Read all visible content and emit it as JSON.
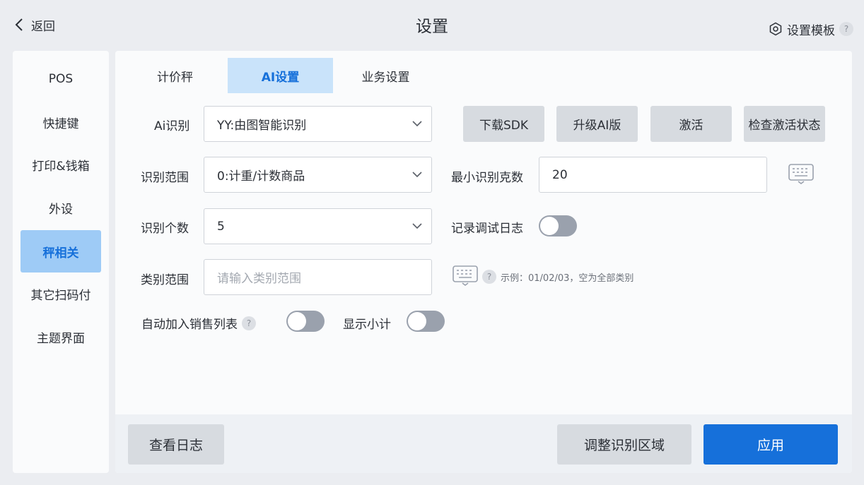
{
  "header": {
    "back_label": "返回",
    "title": "设置",
    "template_label": "设置模板",
    "help_mark": "?"
  },
  "sidebar": {
    "items": [
      {
        "label": "POS"
      },
      {
        "label": "快捷键"
      },
      {
        "label": "打印&钱箱"
      },
      {
        "label": "外设"
      },
      {
        "label": "秤相关",
        "active": true
      },
      {
        "label": "其它扫码付"
      },
      {
        "label": "主题界面"
      }
    ]
  },
  "tabs": [
    {
      "label": "计价秤"
    },
    {
      "label": "AI设置",
      "active": true
    },
    {
      "label": "业务设置"
    }
  ],
  "form": {
    "ai_recognition": {
      "label": "Ai识别",
      "value": "YY:由图智能识别"
    },
    "recognition_range": {
      "label": "识别范围",
      "value": "0:计重/计数商品"
    },
    "recognition_count": {
      "label": "识别个数",
      "value": "5"
    },
    "category_range": {
      "label": "类别范围",
      "placeholder": "请输入类别范围"
    },
    "min_grams": {
      "label": "最小识别克数",
      "value": "20"
    },
    "debug_log": {
      "label": "记录调试日志",
      "on": false
    },
    "auto_add": {
      "label": "自动加入销售列表",
      "on": false
    },
    "show_subtotal": {
      "label": "显示小计",
      "on": false
    },
    "category_hint": "示例：01/02/03，空为全部类别",
    "help_mark": "?"
  },
  "actions": {
    "download_sdk": "下载SDK",
    "upgrade_ai": "升级AI版",
    "activate": "激活",
    "check_activation": "检查激活状态"
  },
  "footer": {
    "view_log": "查看日志",
    "adjust_region": "调整识别区域",
    "apply": "应用"
  },
  "colors": {
    "accent": "#1670da",
    "active_bg": "#9ecbf6",
    "tab_active_bg": "#c9e3fa",
    "button_gray": "#d7dbe0",
    "toggle_off": "#9aa1ad"
  }
}
